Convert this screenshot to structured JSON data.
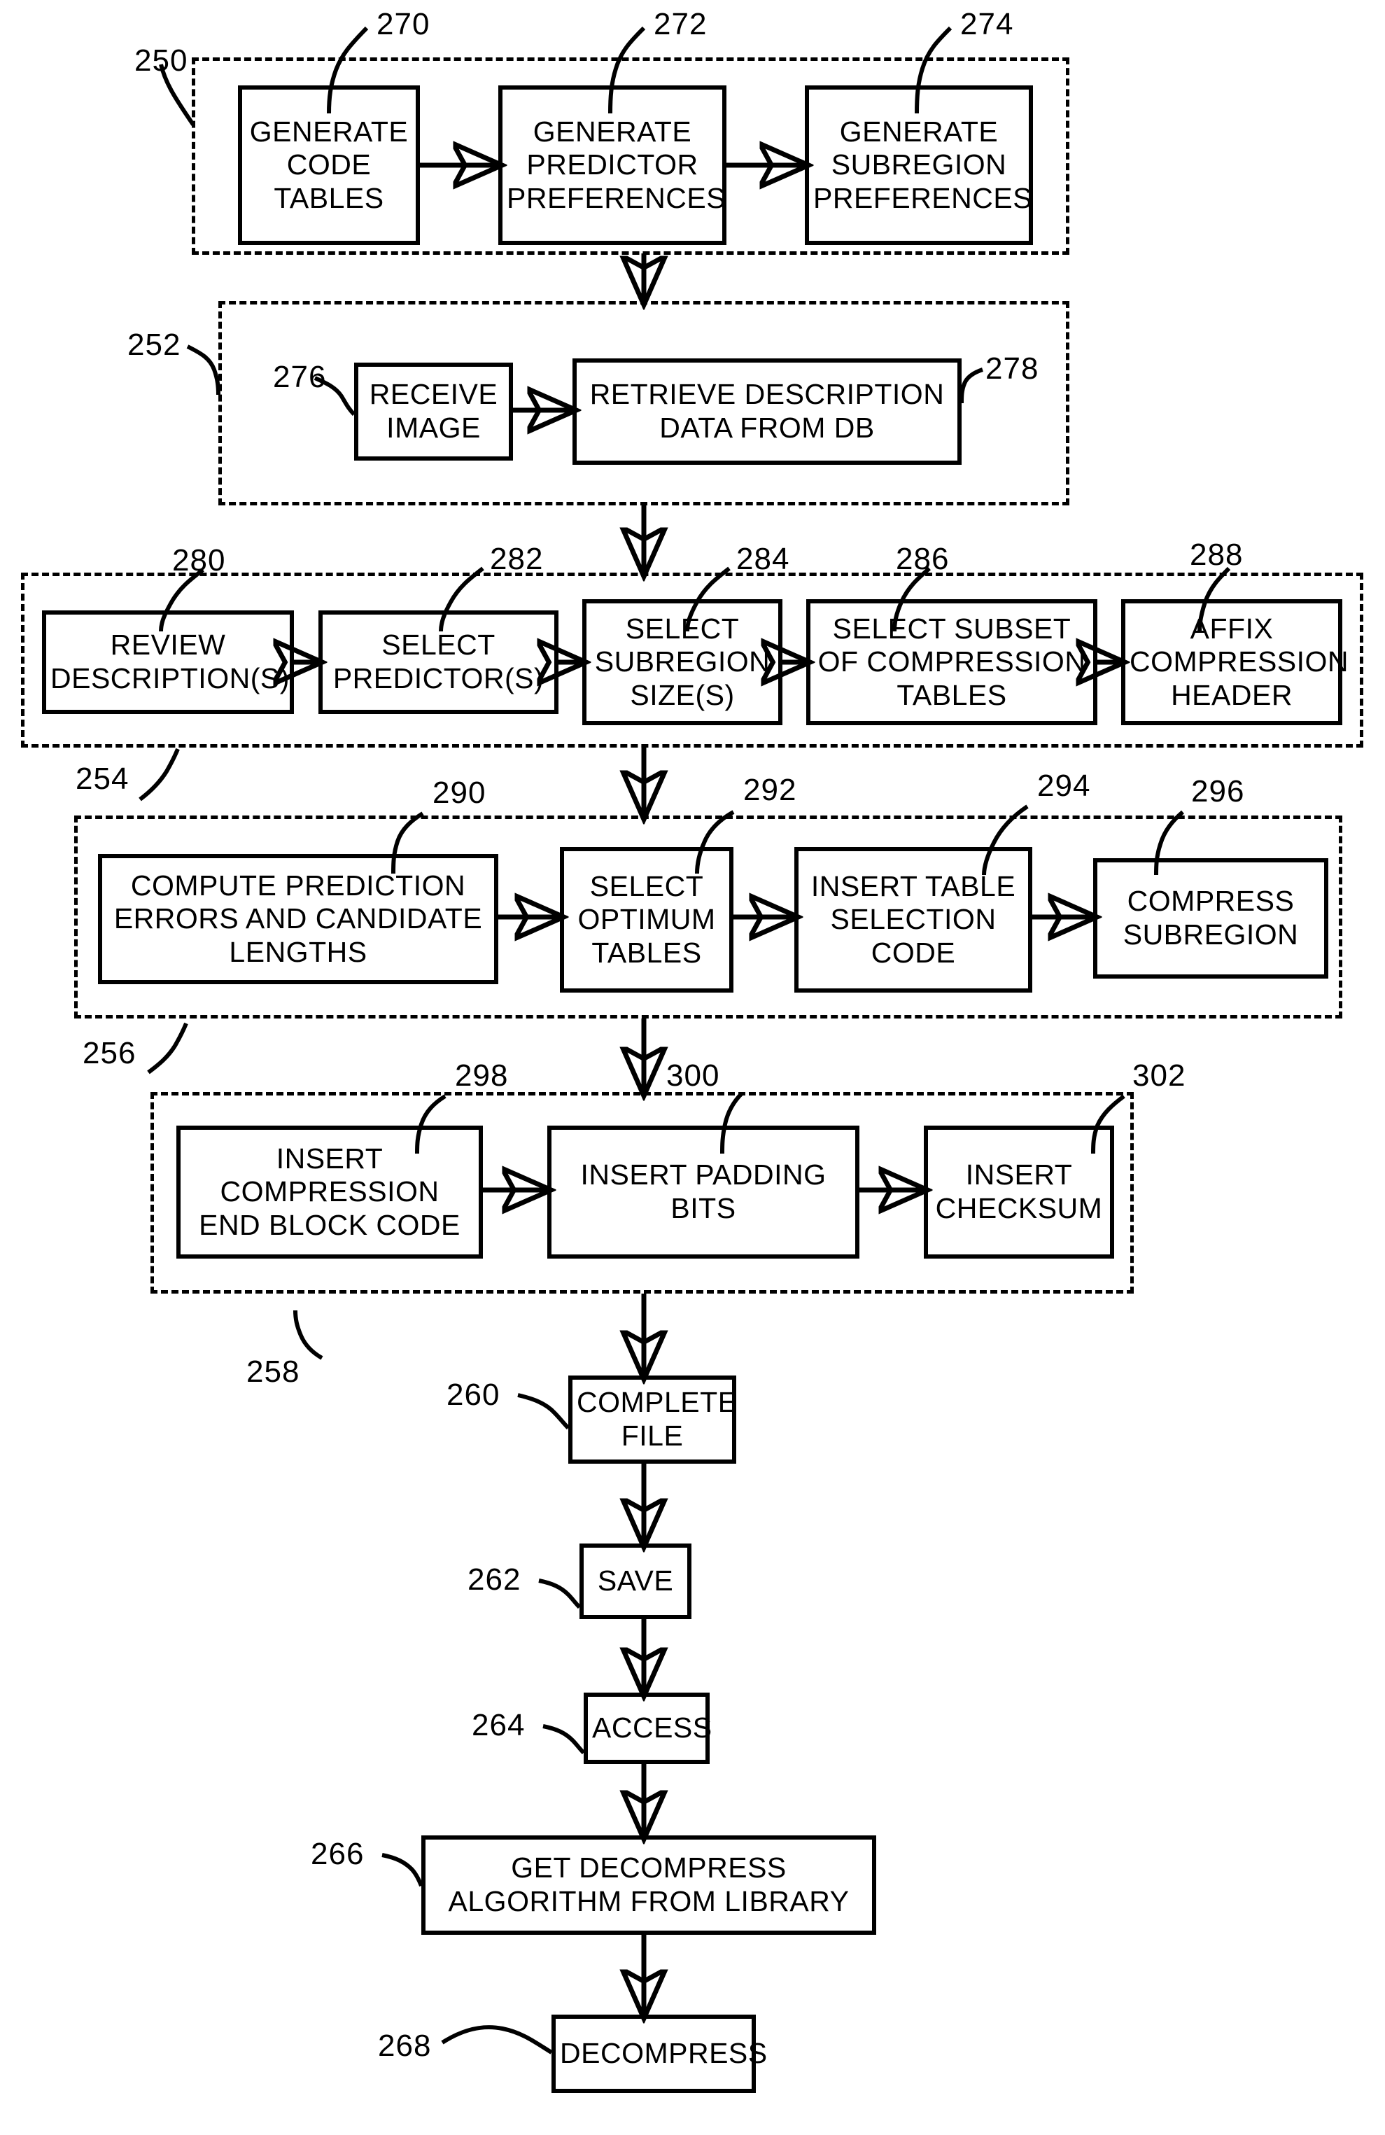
{
  "figure": {
    "type": "patent-flowchart",
    "groups": [
      {
        "ref": "250",
        "steps": [
          {
            "ref": "270",
            "label": "GENERATE\nCODE\nTABLES"
          },
          {
            "ref": "272",
            "label": "GENERATE\nPREDICTOR\nPREFERENCES"
          },
          {
            "ref": "274",
            "label": "GENERATE\nSUBREGION\nPREFERENCES"
          }
        ]
      },
      {
        "ref": "252",
        "steps": [
          {
            "ref": "276",
            "label": "RECEIVE\nIMAGE"
          },
          {
            "ref": "278",
            "label": "RETRIEVE  DESCRIPTION\nDATA  FROM  DB"
          }
        ]
      },
      {
        "ref": "254",
        "steps": [
          {
            "ref": "280",
            "label": "REVIEW\nDESCRIPTION(S)"
          },
          {
            "ref": "282",
            "label": "SELECT\nPREDICTOR(S)"
          },
          {
            "ref": "284",
            "label": "SELECT\nSUBREGION\nSIZE(S)"
          },
          {
            "ref": "286",
            "label": "SELECT SUBSET\nOF COMPRESSION\nTABLES"
          },
          {
            "ref": "288",
            "label": "AFFIX\nCOMPRESSION\nHEADER"
          }
        ]
      },
      {
        "ref": "256",
        "steps": [
          {
            "ref": "290",
            "label": "COMPUTE PREDICTION\nERRORS AND CANDIDATE\nLENGTHS"
          },
          {
            "ref": "292",
            "label": "SELECT\nOPTIMUM\nTABLES"
          },
          {
            "ref": "294",
            "label": "INSERT TABLE\nSELECTION\nCODE"
          },
          {
            "ref": "296",
            "label": "COMPRESS\nSUBREGION"
          }
        ]
      },
      {
        "ref": "258",
        "steps": [
          {
            "ref": "298",
            "label": "INSERT\nCOMPRESSION\nEND BLOCK CODE"
          },
          {
            "ref": "300",
            "label": "INSERT PADDING\nBITS"
          },
          {
            "ref": "302",
            "label": "INSERT\nCHECKSUM"
          }
        ]
      }
    ],
    "tail_steps": [
      {
        "ref": "260",
        "label": "COMPLETE\nFILE"
      },
      {
        "ref": "262",
        "label": "SAVE"
      },
      {
        "ref": "264",
        "label": "ACCESS"
      },
      {
        "ref": "266",
        "label": "GET DECOMPRESS\nALGORITHM  FROM  LIBRARY"
      },
      {
        "ref": "268",
        "label": "DECOMPRESS"
      }
    ]
  }
}
